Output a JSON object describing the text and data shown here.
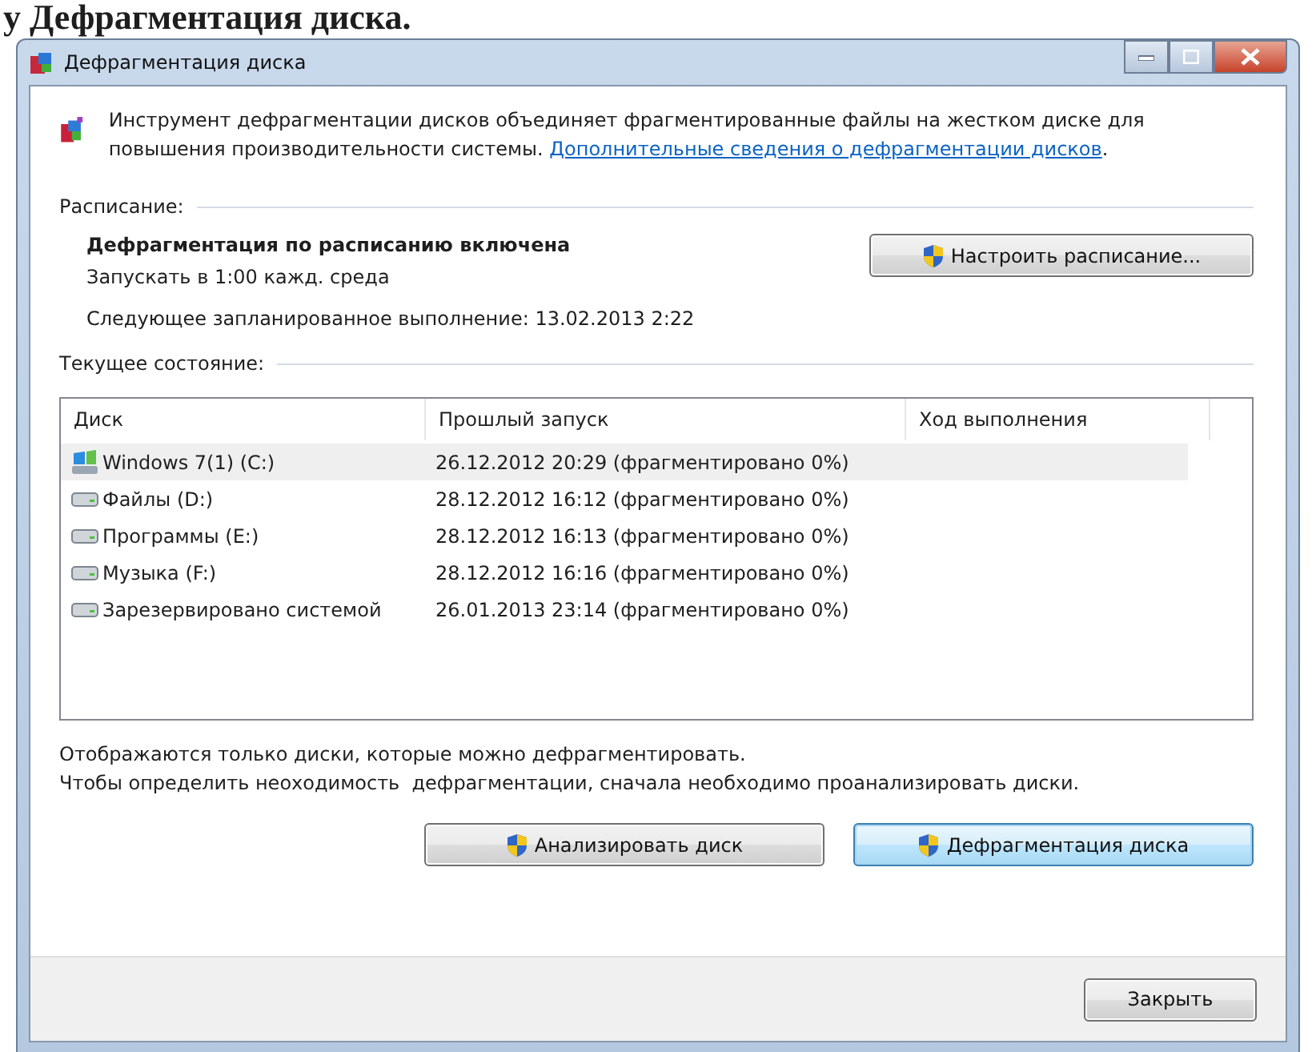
{
  "page_heading": "у Дефрагментация диска.",
  "window": {
    "title": "Дефрагментация диска"
  },
  "intro": {
    "text": "Инструмент дефрагментации дисков объединяет фрагментированные файлы на жестком диске для повышения производительности системы.",
    "link": "Дополнительные сведения о дефрагментации дисков",
    "after_link": "."
  },
  "schedule": {
    "heading": "Расписание:",
    "status": "Дефрагментация по расписанию включена",
    "run": "Запускать в 1:00 кажд. среда",
    "next": "Следующее запланированное выполнение: 13.02.2013 2:22",
    "button": "Настроить расписание..."
  },
  "current": {
    "heading": "Текущее состояние:"
  },
  "table": {
    "columns": [
      "Диск",
      "Прошлый запуск",
      "Ход выполнения"
    ],
    "rows": [
      {
        "kind": "system",
        "disk": "Windows 7(1) (C:)",
        "last_run": "26.12.2012 20:29 (фрагментировано 0%)",
        "selected": true
      },
      {
        "kind": "drive",
        "disk": "Файлы (D:)",
        "last_run": "28.12.2012 16:12 (фрагментировано 0%)",
        "selected": false
      },
      {
        "kind": "drive",
        "disk": "Программы (E:)",
        "last_run": "28.12.2012 16:13 (фрагментировано 0%)",
        "selected": false
      },
      {
        "kind": "drive",
        "disk": "Музыка (F:)",
        "last_run": "28.12.2012 16:16 (фрагментировано 0%)",
        "selected": false
      },
      {
        "kind": "drive",
        "disk": "Зарезервировано системой",
        "last_run": "26.01.2013 23:14 (фрагментировано 0%)",
        "selected": false
      }
    ]
  },
  "notes": [
    "Отображаются только диски, которые можно дефрагментировать.",
    "Чтобы определить неоходимость  дефрагментации, сначала необходимо проанализировать диски."
  ],
  "actions": [
    {
      "label": "Анализировать диск",
      "focused": false
    },
    {
      "label": "Дефрагментация диска",
      "focused": true
    }
  ],
  "close_button": "Закрыть"
}
